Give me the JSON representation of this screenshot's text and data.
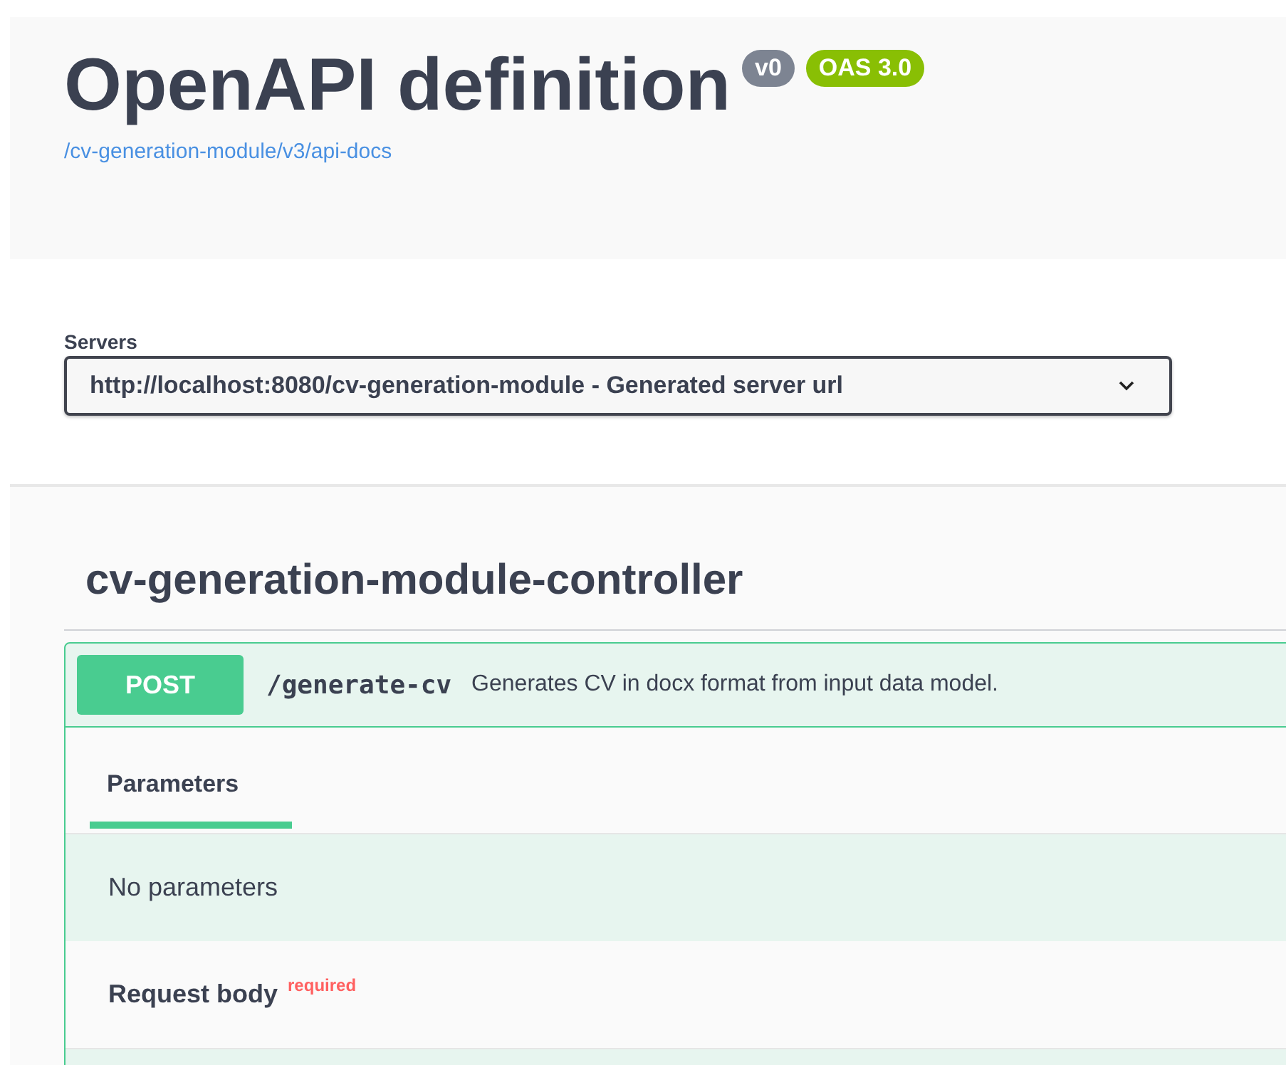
{
  "info": {
    "title": "OpenAPI definition",
    "version": "v0",
    "oas": "OAS 3.0",
    "url": "/cv-generation-module/v3/api-docs"
  },
  "servers": {
    "label": "Servers",
    "value": "http://localhost:8080/cv-generation-module - Generated server url"
  },
  "tag": {
    "name": "cv-generation-module-controller"
  },
  "operation": {
    "kind": "post",
    "method": "POST",
    "path": "/generate-cv",
    "summary": "Generates CV in docx format from input data model.",
    "tabs": [
      {
        "label": "Parameters",
        "selected": true
      }
    ],
    "parameters_text": "No parameters",
    "request_body": {
      "label": "Request body",
      "required": true,
      "required_text": "required"
    }
  }
}
